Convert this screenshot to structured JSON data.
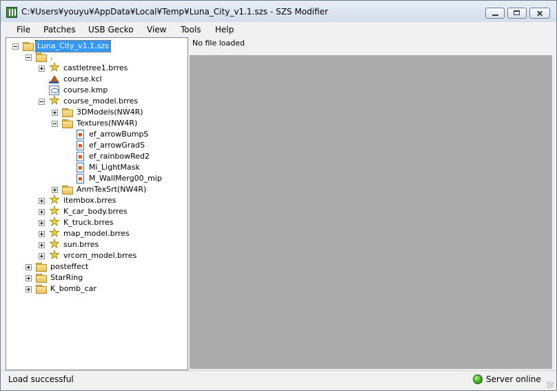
{
  "window": {
    "title": "C:¥Users¥youyu¥AppData¥Local¥Temp¥Luna_City_v1.1.szs - SZS Modifier",
    "icon": "app-icon",
    "controls": [
      "minimize-icon",
      "maximize-icon",
      "close-icon"
    ]
  },
  "menu": {
    "file": "File",
    "patches": "Patches",
    "usb_gecko": "USB Gecko",
    "view": "View",
    "tools": "Tools",
    "help": "Help"
  },
  "tree": {
    "nodes": [
      {
        "label": "Luna_City_v1.1.szs",
        "icon": "folder-icon",
        "expander": "minus",
        "selected": true
      },
      {
        "label": ".",
        "icon": "folder-icon",
        "expander": "minus"
      },
      {
        "label": "castletree1.brres",
        "icon": "brres-star-icon",
        "expander": "plus"
      },
      {
        "label": "course.kcl",
        "icon": "kcl-icon",
        "expander": "none"
      },
      {
        "label": "course.kmp",
        "icon": "kmp-icon",
        "expander": "none"
      },
      {
        "label": "course_model.brres",
        "icon": "brres-star-icon",
        "expander": "minus"
      },
      {
        "label": "3DModels(NW4R)",
        "icon": "folder-icon",
        "expander": "plus"
      },
      {
        "label": "Textures(NW4R)",
        "icon": "folder-icon",
        "expander": "minus"
      },
      {
        "label": "ef_arrowBumpS",
        "icon": "texture-icon",
        "expander": "none"
      },
      {
        "label": "ef_arrowGradS",
        "icon": "texture-icon",
        "expander": "none"
      },
      {
        "label": "ef_rainbowRed2",
        "icon": "texture-icon",
        "expander": "none"
      },
      {
        "label": "Mi_LightMask",
        "icon": "texture-icon",
        "expander": "none"
      },
      {
        "label": "M_WallMerg00_mip",
        "icon": "texture-icon",
        "expander": "none"
      },
      {
        "label": "AnmTexSrt(NW4R)",
        "icon": "folder-icon",
        "expander": "plus"
      },
      {
        "label": "itembox.brres",
        "icon": "brres-star-icon",
        "expander": "plus"
      },
      {
        "label": "K_car_body.brres",
        "icon": "brres-star-icon",
        "expander": "plus"
      },
      {
        "label": "K_truck.brres",
        "icon": "brres-star-icon",
        "expander": "plus"
      },
      {
        "label": "map_model.brres",
        "icon": "brres-star-icon",
        "expander": "plus"
      },
      {
        "label": "sun.brres",
        "icon": "brres-star-icon",
        "expander": "plus"
      },
      {
        "label": "vrcorn_model.brres",
        "icon": "brres-star-icon",
        "expander": "plus"
      },
      {
        "label": "posteffect",
        "icon": "folder-icon",
        "expander": "plus"
      },
      {
        "label": "StarRing",
        "icon": "folder-icon",
        "expander": "plus"
      },
      {
        "label": "K_bomb_car",
        "icon": "folder-icon",
        "expander": "plus"
      }
    ]
  },
  "content": {
    "header_text": "No file loaded"
  },
  "status": {
    "message": "Load successful",
    "server": "Server online",
    "server_color": "#3fb21e"
  }
}
